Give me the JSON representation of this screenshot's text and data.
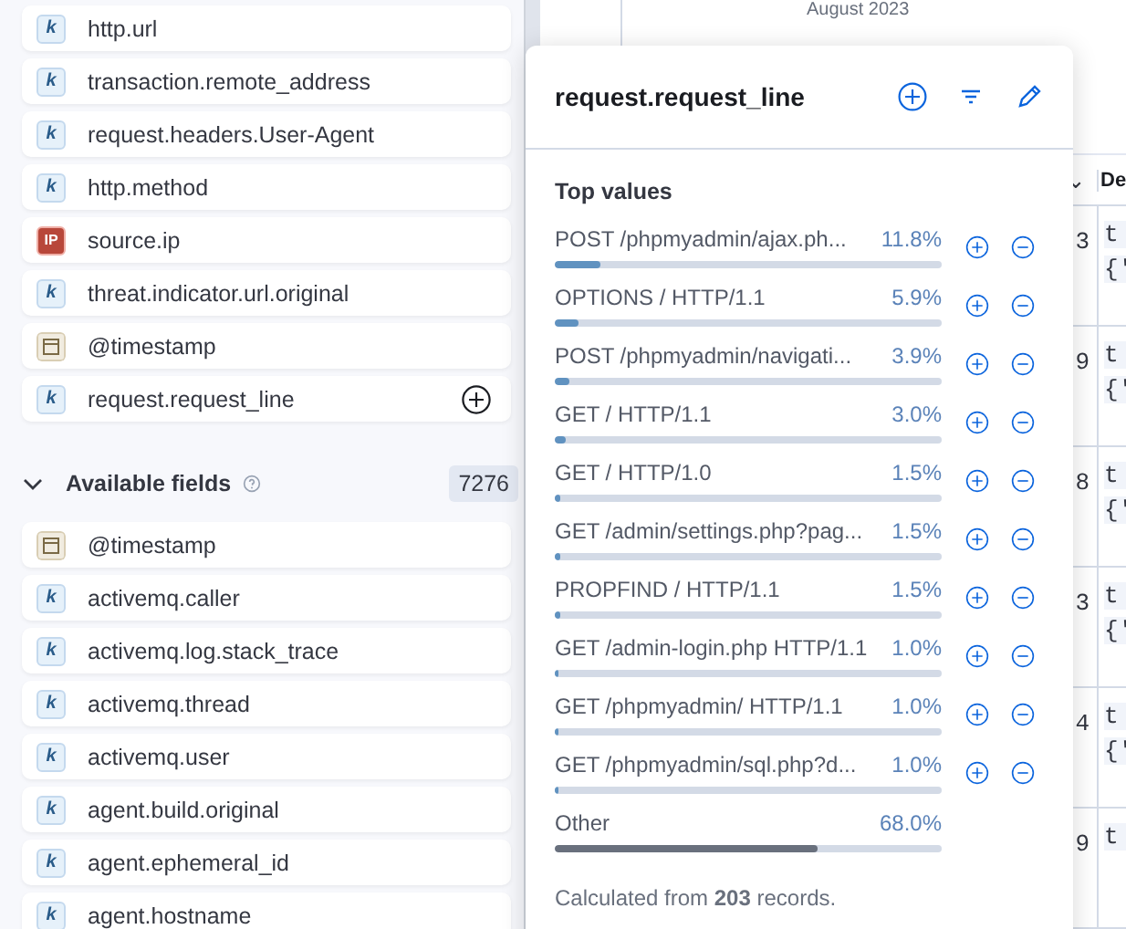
{
  "header": {
    "date": "August 2023"
  },
  "selected_fields": [
    {
      "name": "http.url",
      "kind": "keyword",
      "token": "k",
      "selected": false
    },
    {
      "name": "transaction.remote_address",
      "kind": "keyword",
      "token": "k",
      "selected": false
    },
    {
      "name": "request.headers.User-Agent",
      "kind": "keyword",
      "token": "k",
      "selected": false
    },
    {
      "name": "http.method",
      "kind": "keyword",
      "token": "k",
      "selected": false
    },
    {
      "name": "source.ip",
      "kind": "ip",
      "token": "IP",
      "selected": false
    },
    {
      "name": "threat.indicator.url.original",
      "kind": "keyword",
      "token": "k",
      "selected": false
    },
    {
      "name": "@timestamp",
      "kind": "date",
      "selected": false
    },
    {
      "name": "request.request_line",
      "kind": "keyword",
      "token": "k",
      "selected": true
    }
  ],
  "available_fields": {
    "title": "Available fields",
    "count": "7276",
    "expanded": true,
    "items": [
      {
        "name": "@timestamp",
        "kind": "date"
      },
      {
        "name": "activemq.caller",
        "kind": "keyword",
        "token": "k"
      },
      {
        "name": "activemq.log.stack_trace",
        "kind": "keyword",
        "token": "k"
      },
      {
        "name": "activemq.thread",
        "kind": "keyword",
        "token": "k"
      },
      {
        "name": "activemq.user",
        "kind": "keyword",
        "token": "k"
      },
      {
        "name": "agent.build.original",
        "kind": "keyword",
        "token": "k"
      },
      {
        "name": "agent.ephemeral_id",
        "kind": "keyword",
        "token": "k"
      },
      {
        "name": "agent.hostname",
        "kind": "keyword",
        "token": "k"
      }
    ]
  },
  "table": {
    "header": {
      "column_1": "⌄",
      "column_2": "De"
    },
    "rows": [
      {
        "column_1": "3",
        "column_2": [
          "t",
          "{'"
        ]
      },
      {
        "column_1": "9",
        "column_2": [
          "t",
          "{'"
        ]
      },
      {
        "column_1": "8",
        "column_2": [
          "t",
          "{'"
        ]
      },
      {
        "column_1": "3",
        "column_2": [
          "t",
          "{'"
        ]
      },
      {
        "column_1": "4",
        "column_2": [
          "t",
          "{'"
        ]
      },
      {
        "column_1": "9",
        "column_2": [
          "t"
        ]
      }
    ]
  },
  "popover": {
    "title": "request.request_line",
    "section_title": "Top values",
    "values": [
      {
        "kind": "value",
        "label": "POST /phpmyadmin/ajax.ph...",
        "percent": "11.8%",
        "level": 0.118
      },
      {
        "kind": "value",
        "label": "OPTIONS / HTTP/1.1",
        "percent": "5.9%",
        "level": 0.059
      },
      {
        "kind": "value",
        "label": "POST /phpmyadmin/navigati...",
        "percent": "3.9%",
        "level": 0.039
      },
      {
        "kind": "value",
        "label": "GET / HTTP/1.1",
        "percent": "3.0%",
        "level": 0.03
      },
      {
        "kind": "value",
        "label": "GET / HTTP/1.0",
        "percent": "1.5%",
        "level": 0.015
      },
      {
        "kind": "value",
        "label": "GET /admin/settings.php?pag...",
        "percent": "1.5%",
        "level": 0.015
      },
      {
        "kind": "value",
        "label": "PROPFIND / HTTP/1.1",
        "percent": "1.5%",
        "level": 0.015
      },
      {
        "kind": "value",
        "label": "GET /admin-login.php HTTP/1.1",
        "percent": "1.0%",
        "level": 0.01
      },
      {
        "kind": "value",
        "label": "GET /phpmyadmin/ HTTP/1.1",
        "percent": "1.0%",
        "level": 0.01
      },
      {
        "kind": "value",
        "label": "GET /phpmyadmin/sql.php?d...",
        "percent": "1.0%",
        "level": 0.01
      },
      {
        "kind": "other",
        "label": "Other",
        "percent": "68.0%",
        "level": 0.68
      }
    ],
    "footer": "Calculated from **203** records."
  }
}
